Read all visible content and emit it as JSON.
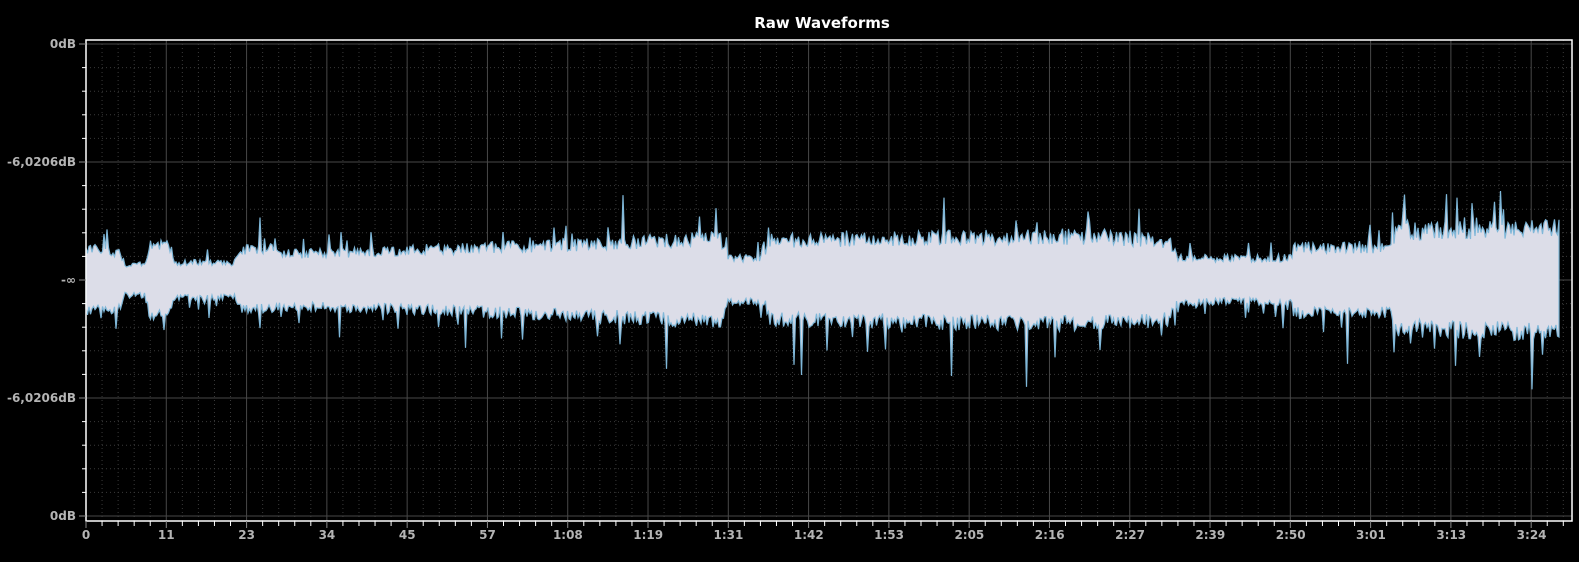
{
  "chart_data": {
    "type": "area",
    "title": "Raw Waveforms",
    "xlabel": "",
    "ylabel": "",
    "x_unit": "seconds",
    "xlim": [
      0,
      209.7
    ],
    "x_tick_values": [
      0,
      11.33,
      22.66,
      34,
      45.33,
      56.66,
      68,
      79.33,
      90.66,
      102,
      113.33,
      124.66,
      136,
      147.33,
      158.66,
      170,
      181.33,
      192.66,
      204
    ],
    "x_tick_labels": [
      "0",
      "11",
      "23",
      "34",
      "45",
      "57",
      "1:08",
      "1:19",
      "1:31",
      "1:42",
      "1:53",
      "2:05",
      "2:16",
      "2:27",
      "2:39",
      "2:50",
      "3:01",
      "3:13",
      "3:24"
    ],
    "y_tick_labels": [
      "0dB",
      "-6,0206dB",
      "-∞",
      "-6,0206dB",
      "0dB"
    ],
    "ylim": [
      -1,
      1
    ],
    "grid": true,
    "series": [
      {
        "name": "waveform",
        "fill_color": "#dcdde8",
        "edge_color": "#7fb7d8",
        "envelope_time": [
          0,
          4.8,
          5.5,
          8.3,
          9.0,
          11.9,
          12.5,
          21,
          22,
          30.2,
          50,
          75.3,
          89.5,
          90.5,
          95.8,
          96.5,
          114.9,
          141.7,
          153,
          154,
          169.9,
          170.5,
          184,
          185,
          208
        ],
        "envelope_amplitude": [
          0.14,
          0.13,
          0.07,
          0.07,
          0.16,
          0.15,
          0.08,
          0.08,
          0.14,
          0.12,
          0.14,
          0.17,
          0.19,
          0.1,
          0.1,
          0.18,
          0.19,
          0.2,
          0.18,
          0.1,
          0.1,
          0.15,
          0.15,
          0.22,
          0.24
        ]
      }
    ]
  },
  "colors": {
    "background": "#000000",
    "axis": "#ffffff",
    "major_grid": "#484848",
    "minor_grid": "#3a3a3a",
    "tick_label": "#b4b4b4",
    "title": "#ffffff"
  }
}
